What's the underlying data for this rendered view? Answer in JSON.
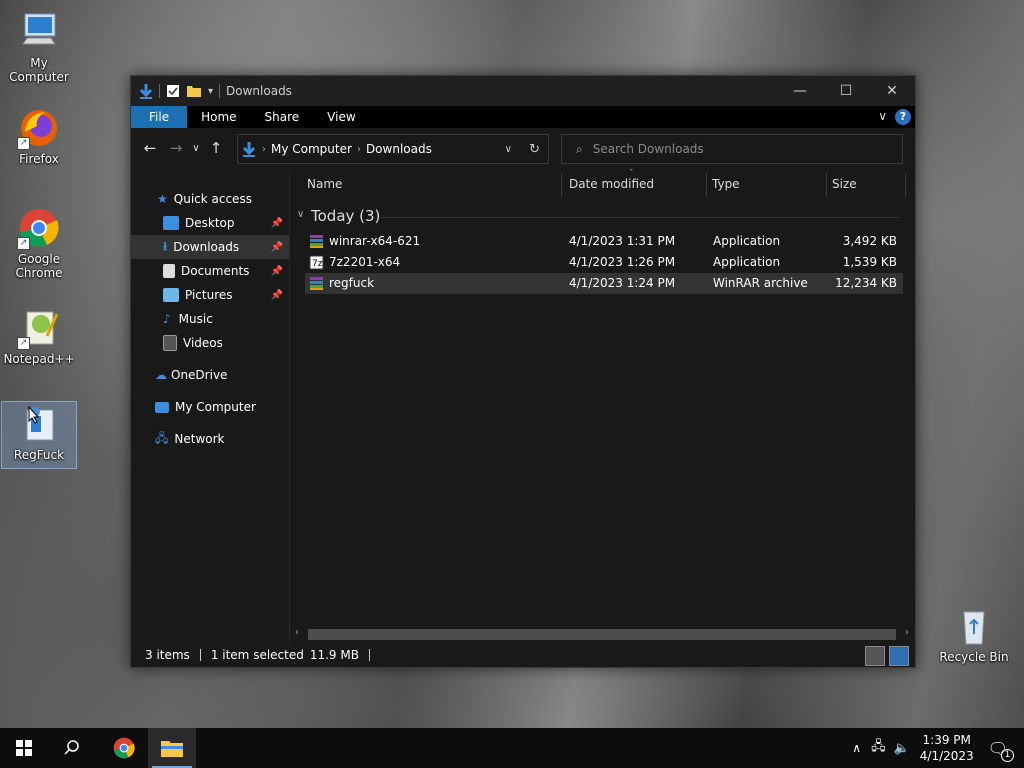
{
  "desktop": {
    "icons": [
      {
        "label": "My Computer"
      },
      {
        "label": "Firefox"
      },
      {
        "label": "Google Chrome"
      },
      {
        "label": "Notepad++"
      },
      {
        "label": "RegFuck"
      },
      {
        "label": "Recycle Bin"
      }
    ]
  },
  "window": {
    "title": "Downloads",
    "ribbon": {
      "file": "File",
      "home": "Home",
      "share": "Share",
      "view": "View",
      "help": "?"
    },
    "address": {
      "crumbs": [
        "My Computer",
        "Downloads"
      ]
    },
    "search": {
      "placeholder": "Search Downloads"
    },
    "nav": {
      "quick_access": "Quick access",
      "desktop": "Desktop",
      "downloads": "Downloads",
      "documents": "Documents",
      "pictures": "Pictures",
      "music": "Music",
      "videos": "Videos",
      "onedrive": "OneDrive",
      "my_computer": "My Computer",
      "network": "Network"
    },
    "columns": {
      "name": "Name",
      "date": "Date modified",
      "type": "Type",
      "size": "Size"
    },
    "group": "Today (3)",
    "files": [
      {
        "name": "winrar-x64-621",
        "date": "4/1/2023 1:31 PM",
        "type": "Application",
        "size": "3,492 KB"
      },
      {
        "name": "7z2201-x64",
        "date": "4/1/2023 1:26 PM",
        "type": "Application",
        "size": "1,539 KB"
      },
      {
        "name": "regfuck",
        "date": "4/1/2023 1:24 PM",
        "type": "WinRAR archive",
        "size": "12,234 KB"
      }
    ],
    "status": {
      "items": "3 items",
      "selected": "1 item selected",
      "size": "11.9 MB"
    }
  },
  "taskbar": {
    "time": "1:39 PM",
    "date": "4/1/2023",
    "notification_count": "1"
  }
}
